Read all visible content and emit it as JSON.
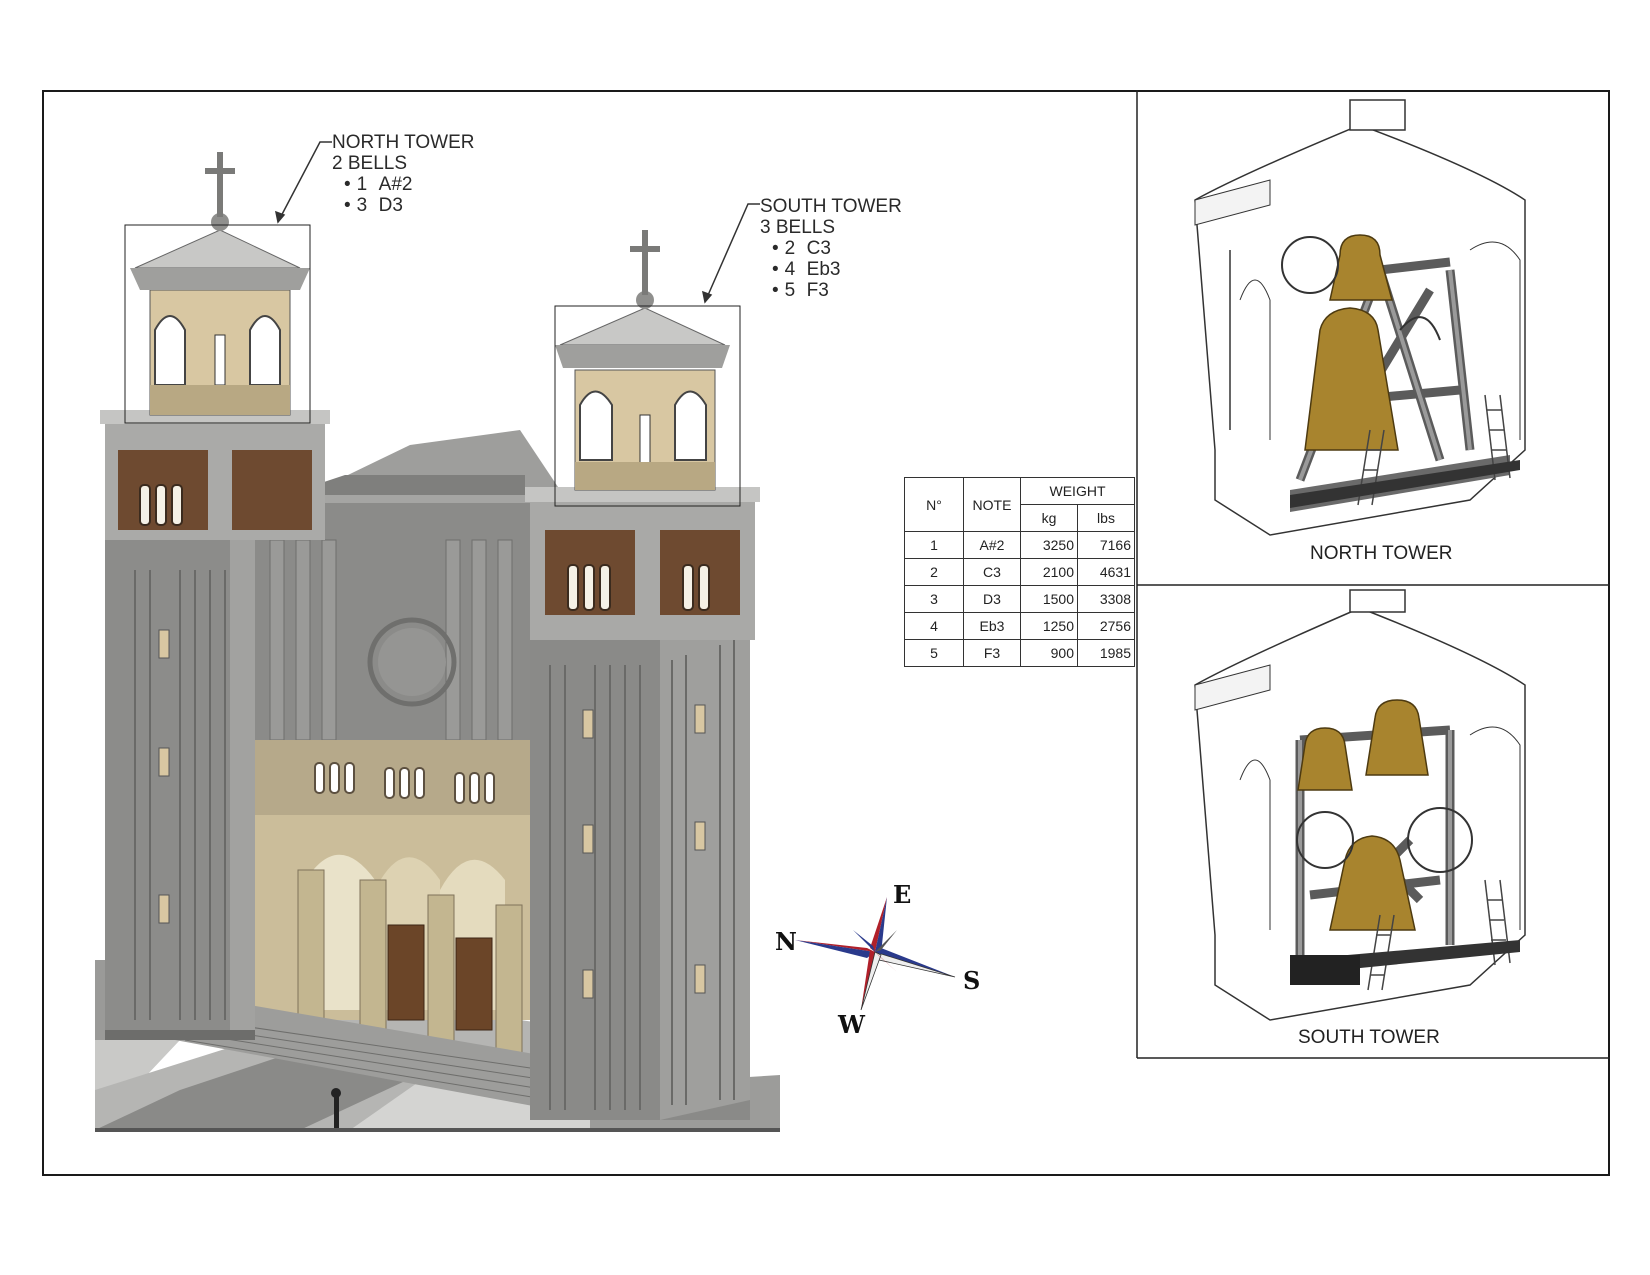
{
  "north_callout": {
    "title": "NORTH TOWER",
    "count": "2 BELLS",
    "bells": [
      {
        "num": "1",
        "note": "A#2"
      },
      {
        "num": "3",
        "note": "D3"
      }
    ]
  },
  "south_callout": {
    "title": "SOUTH TOWER",
    "count": "3 BELLS",
    "bells": [
      {
        "num": "2",
        "note": "C3"
      },
      {
        "num": "4",
        "note": "Eb3"
      },
      {
        "num": "5",
        "note": "F3"
      }
    ]
  },
  "bell_table": {
    "headers": {
      "num": "N°",
      "note": "NOTE",
      "weight": "WEIGHT",
      "kg": "kg",
      "lbs": "lbs"
    },
    "rows": [
      {
        "num": "1",
        "note": "A#2",
        "kg": "3250",
        "lbs": "7166"
      },
      {
        "num": "2",
        "note": "C3",
        "kg": "2100",
        "lbs": "4631"
      },
      {
        "num": "3",
        "note": "D3",
        "kg": "1500",
        "lbs": "3308"
      },
      {
        "num": "4",
        "note": "Eb3",
        "kg": "1250",
        "lbs": "2756"
      },
      {
        "num": "5",
        "note": "F3",
        "kg": "900",
        "lbs": "1985"
      }
    ]
  },
  "views": {
    "north_label": "NORTH TOWER",
    "south_label": "SOUTH TOWER"
  },
  "compass": {
    "n": "N",
    "e": "E",
    "s": "S",
    "w": "W"
  },
  "colors": {
    "facade_gray": "#8f8f8d",
    "tower_beige": "#d8c7a2",
    "bronze": "#a8842e",
    "louver_brown": "#6e4a30",
    "compass_red": "#b0202a",
    "compass_blue": "#2a3a8c"
  }
}
